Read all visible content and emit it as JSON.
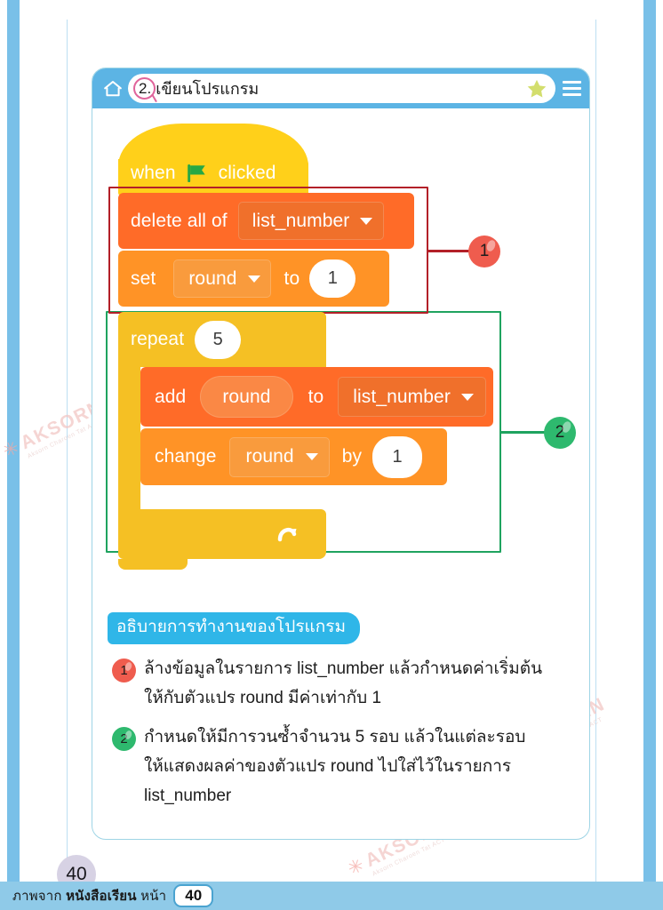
{
  "header": {
    "home_icon": "home-icon",
    "number": "2.",
    "title": "เขียนโปรแกรม",
    "star_icon": "star-icon",
    "menu_icon": "hamburger-menu-icon"
  },
  "blocks": {
    "hat": {
      "when": "when",
      "flag_icon": "green-flag-icon",
      "clicked": "clicked"
    },
    "delete": {
      "label": "delete all of",
      "dropdown": "list_number"
    },
    "set": {
      "label": "set",
      "dropdown": "round",
      "to": "to",
      "value": "1"
    },
    "repeat": {
      "label": "repeat",
      "value": "5",
      "loop_icon": "loop-arrow-icon"
    },
    "add": {
      "label": "add",
      "variable": "round",
      "to": "to",
      "dropdown": "list_number"
    },
    "change": {
      "label": "change",
      "dropdown": "round",
      "by": "by",
      "value": "1"
    }
  },
  "annotations": {
    "marker_1": "1",
    "marker_2": "2",
    "box_1_color": "#b32028",
    "box_2_color": "#1fa35f",
    "marker_1_color": "#ef5c4e",
    "marker_2_color": "#2eb96e"
  },
  "explanation": {
    "label": "อธิบายการทำงานของโปรแกรม",
    "items": [
      {
        "number": "1",
        "lines": [
          "ล้างข้อมูลในรายการ  list_number  แล้วกำหนดค่าเริ่มต้น",
          "ให้กับตัวแปร round  มีค่าเท่ากับ 1"
        ]
      },
      {
        "number": "2",
        "lines": [
          "กำหนดให้มีการวนซ้ำจำนวน  5  รอบ  แล้วในแต่ละรอบ",
          "ให้แสดงผลค่าของตัวแปร  round  ไปใส่ไว้ในรายการ",
          "list_number"
        ]
      }
    ]
  },
  "page_number": "40",
  "footer": {
    "prefix": "ภาพจาก ",
    "bold": "หนังสือเรียน",
    "suffix": " หน้า",
    "page": "40"
  },
  "watermark": {
    "text": "AKSORN",
    "sub": "Aksorn Charoen Tat ACT"
  },
  "colors": {
    "frame_blue": "#79c0e8",
    "header_blue": "#5cb4e4",
    "accent_cyan": "#2fb6e8",
    "list_block": "#ff6b28",
    "variable_block": "#ff9326",
    "control_block": "#f5c024",
    "event_block": "#ffd01a"
  }
}
